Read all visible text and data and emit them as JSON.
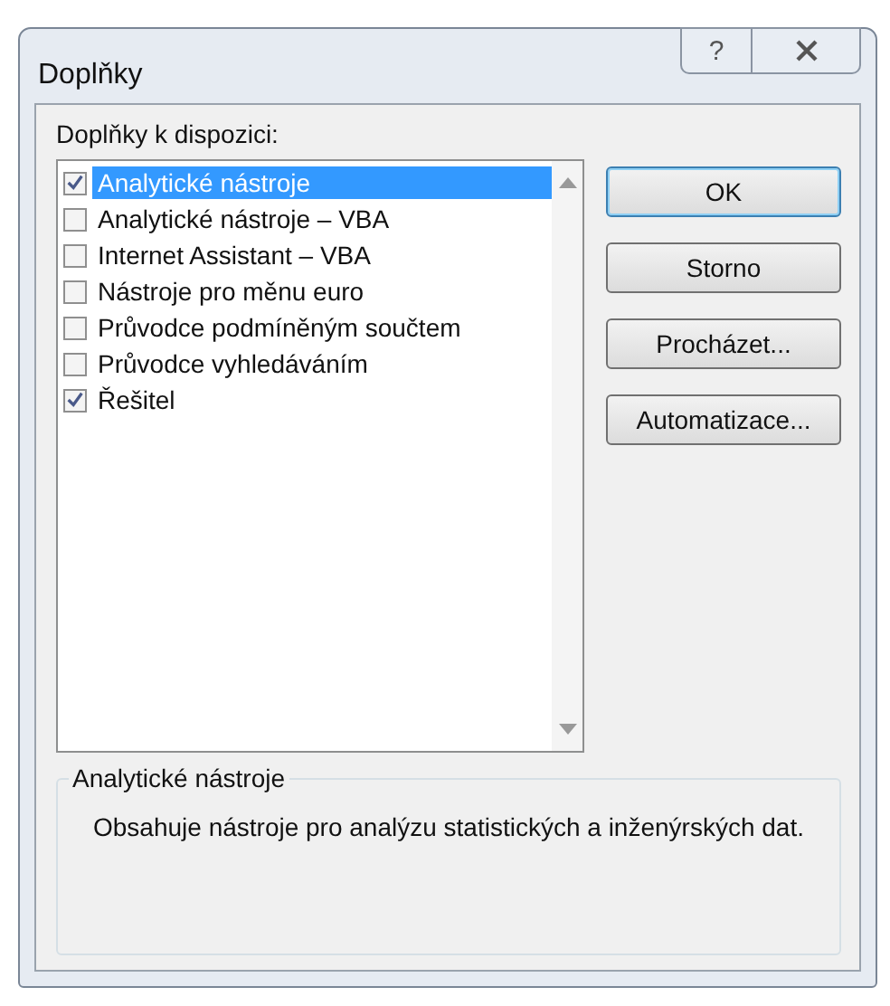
{
  "window": {
    "title": "Doplňky",
    "help_button": "?"
  },
  "list": {
    "label": "Doplňky k dispozici:",
    "items": [
      {
        "label": "Analytické nástroje",
        "checked": true,
        "selected": true
      },
      {
        "label": "Analytické nástroje – VBA",
        "checked": false,
        "selected": false
      },
      {
        "label": "Internet Assistant – VBA",
        "checked": false,
        "selected": false
      },
      {
        "label": "Nástroje pro měnu euro",
        "checked": false,
        "selected": false
      },
      {
        "label": "Průvodce podmíněným součtem",
        "checked": false,
        "selected": false
      },
      {
        "label": "Průvodce vyhledáváním",
        "checked": false,
        "selected": false
      },
      {
        "label": "Řešitel",
        "checked": true,
        "selected": false
      }
    ]
  },
  "buttons": [
    {
      "label": "OK",
      "default": true
    },
    {
      "label": "Storno",
      "default": false
    },
    {
      "label": "Procházet...",
      "default": false
    },
    {
      "label": "Automatizace...",
      "default": false
    }
  ],
  "description": {
    "title": "Analytické nástroje",
    "text": "Obsahuje nástroje pro analýzu statistických a inženýrských dat."
  }
}
